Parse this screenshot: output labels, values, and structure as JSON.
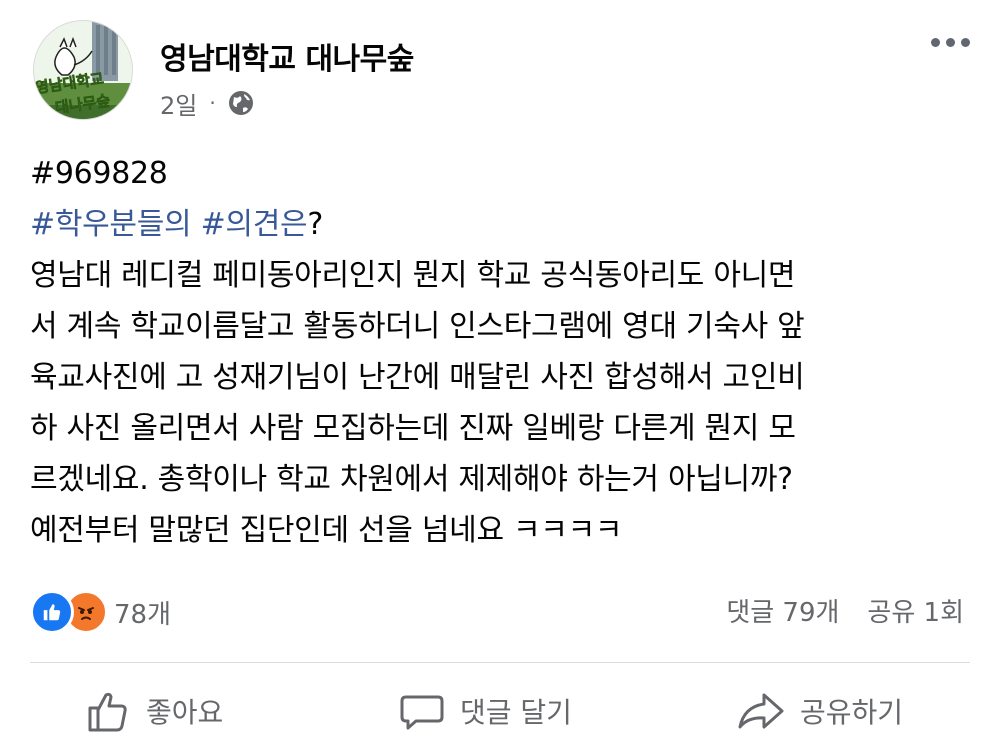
{
  "page": {
    "name": "영남대학교 대나무숲",
    "time": "2일",
    "separator": "·",
    "avatar_text_line1": "영남대학교",
    "avatar_text_line2": "대나무숲"
  },
  "post": {
    "number": "#969828",
    "hashtag1": "#학우분들의",
    "hashtag2": "#의견은",
    "hashtag_suffix": "?",
    "lines": [
      "영남대 레디컬 페미동아리인지 뭔지 학교 공식동아리도 아니면",
      "서 계속 학교이름달고 활동하더니 인스타그램에 영대 기숙사 앞",
      "육교사진에 고 성재기님이 난간에 매달린 사진 합성해서 고인비",
      "하 사진 올리면서 사람 모집하는데 진짜 일베랑 다른게 뭔지 모",
      "르겠네요. 총학이나 학교 차원에서 제제해야 하는거 아닙니까?",
      "예전부터 말많던 집단인데 선을 넘네요 ㅋㅋㅋㅋ"
    ]
  },
  "stats": {
    "reactions": "78개",
    "comments": "댓글 79개",
    "shares": "공유 1회"
  },
  "actions": {
    "like": "좋아요",
    "comment": "댓글 달기",
    "share": "공유하기"
  },
  "colors": {
    "hashtag": "#385898",
    "meta": "#65676b",
    "like": "#1877f2",
    "angry": "#f3782c"
  },
  "icons": [
    "more-icon",
    "globe-icon",
    "like-reaction-icon",
    "angry-reaction-icon",
    "thumbs-up-icon",
    "comment-icon",
    "share-icon"
  ]
}
